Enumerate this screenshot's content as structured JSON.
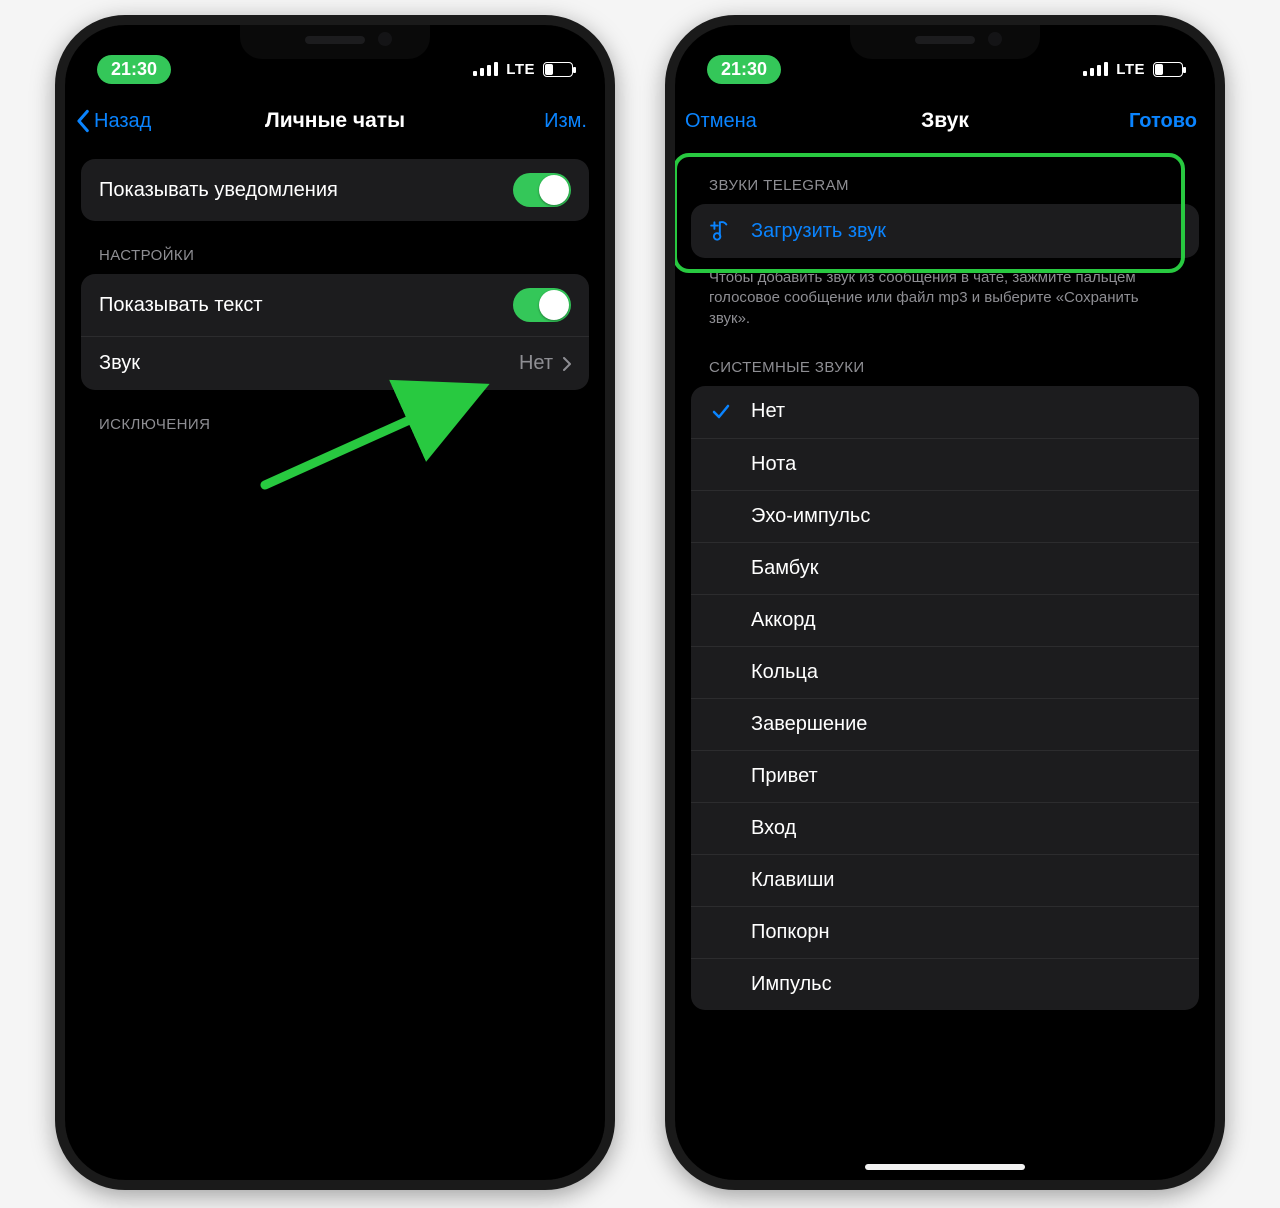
{
  "status": {
    "time": "21:30",
    "network": "LTE"
  },
  "left": {
    "nav": {
      "back": "Назад",
      "title": "Личные чаты",
      "edit": "Изм."
    },
    "rows": {
      "show_notifications": "Показывать уведомления",
      "settings_header": "НАСТРОЙКИ",
      "show_text": "Показывать текст",
      "sound": "Звук",
      "sound_value": "Нет",
      "exceptions_header": "ИСКЛЮЧЕНИЯ"
    }
  },
  "right": {
    "nav": {
      "cancel": "Отмена",
      "title": "Звук",
      "done": "Готово"
    },
    "telegram_sounds_header": "ЗВУКИ TELEGRAM",
    "upload_sound": "Загрузить звук",
    "upload_hint": "Чтобы добавить звук из сообщения в чате, зажмите пальцем голосовое сообщение или файл mp3 и выберите «Сохранить звук».",
    "system_sounds_header": "СИСТЕМНЫЕ ЗВУКИ",
    "sounds": [
      {
        "label": "Нет",
        "selected": true
      },
      {
        "label": "Нота",
        "selected": false
      },
      {
        "label": "Эхо-импульс",
        "selected": false
      },
      {
        "label": "Бамбук",
        "selected": false
      },
      {
        "label": "Аккорд",
        "selected": false
      },
      {
        "label": "Кольца",
        "selected": false
      },
      {
        "label": "Завершение",
        "selected": false
      },
      {
        "label": "Привет",
        "selected": false
      },
      {
        "label": "Вход",
        "selected": false
      },
      {
        "label": "Клавиши",
        "selected": false
      },
      {
        "label": "Попкорн",
        "selected": false
      },
      {
        "label": "Импульс",
        "selected": false
      }
    ]
  },
  "colors": {
    "accent_blue": "#0a84ff",
    "toggle_green": "#34c759",
    "highlight_green": "#28c940",
    "card_bg": "#1c1c1e",
    "secondary_text": "#8e8e93"
  }
}
